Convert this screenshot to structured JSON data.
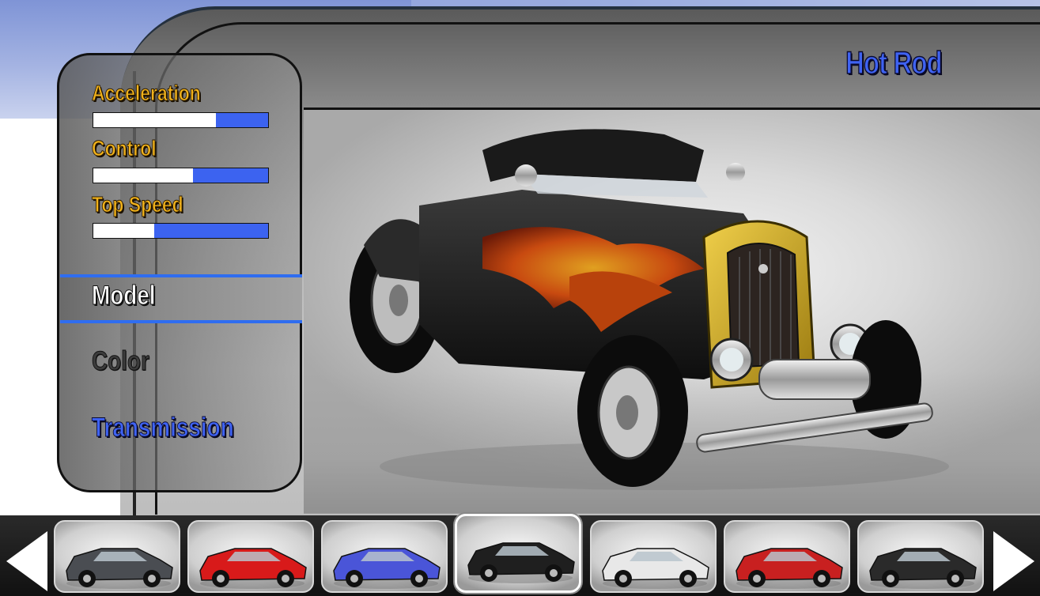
{
  "car_name": "Hot Rod",
  "stats": [
    {
      "label": "Acceleration",
      "value": 0.7
    },
    {
      "label": "Control",
      "value": 0.57
    },
    {
      "label": "Top Speed",
      "value": 0.35
    }
  ],
  "menu": {
    "items": [
      "Model",
      "Color",
      "Transmission"
    ],
    "selected": "Model"
  },
  "carousel": {
    "selected_index": 3,
    "cars": [
      {
        "icon": "gray-sports-coupe",
        "color": "#4a4d52"
      },
      {
        "icon": "red-supercar",
        "color": "#d81a1a"
      },
      {
        "icon": "blue-roadster",
        "color": "#4a55d8"
      },
      {
        "icon": "hot-rod-flames",
        "color": "#1f1f1f"
      },
      {
        "icon": "police-cruiser",
        "color": "#e8e8e8"
      },
      {
        "icon": "race-stock-car",
        "color": "#c82020"
      },
      {
        "icon": "classic-sedan",
        "color": "#2a2a2a"
      }
    ]
  },
  "colors": {
    "accent_blue": "#3f63f2",
    "stat_label_gold": "#f2b31c",
    "hot_rod_body": "#1f1f1f",
    "hot_rod_nose": "#d9b020"
  }
}
